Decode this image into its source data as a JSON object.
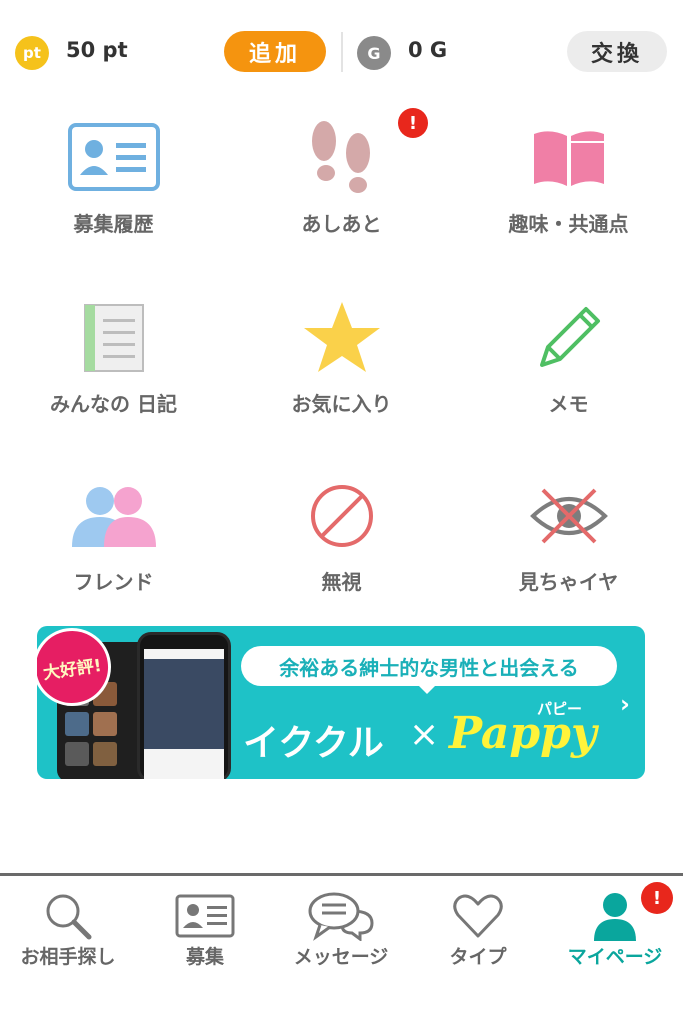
{
  "header": {
    "pt_icon": "pt",
    "points": "50 pt",
    "add_label": "追加",
    "g_icon": "G",
    "gold": "0 G",
    "exchange_label": "交換"
  },
  "menu": {
    "items": [
      {
        "label": "募集履歴",
        "icon": "id-card-icon"
      },
      {
        "label": "あしあと",
        "icon": "footprints-icon",
        "badge": "!"
      },
      {
        "label": "趣味・共通点",
        "icon": "open-book-icon"
      },
      {
        "label": "みんなの 日記",
        "icon": "notebook-icon"
      },
      {
        "label": "お気に入り",
        "icon": "star-icon"
      },
      {
        "label": "メモ",
        "icon": "pencil-icon"
      },
      {
        "label": "フレンド",
        "icon": "friends-icon"
      },
      {
        "label": "無視",
        "icon": "prohibited-icon"
      },
      {
        "label": "見ちゃイヤ",
        "icon": "eye-crossed-icon"
      }
    ]
  },
  "banner": {
    "badge": "大好評!",
    "headline": "余裕ある紳士的な男性と出会える",
    "brand_left": "イククル",
    "cross": "×",
    "brand_right": "Pappy",
    "brand_right_ruby": "パピー",
    "chevron": "›"
  },
  "nav": {
    "items": [
      {
        "label": "お相手探し",
        "icon": "search-icon"
      },
      {
        "label": "募集",
        "icon": "id-card-icon"
      },
      {
        "label": "メッセージ",
        "icon": "chat-bubbles-icon"
      },
      {
        "label": "タイプ",
        "icon": "heart-icon"
      },
      {
        "label": "マイページ",
        "icon": "person-icon",
        "active": true,
        "badge": "!"
      }
    ]
  },
  "colors": {
    "accent": "#0aa69d",
    "orange": "#f5940f",
    "badge_red": "#e8271c",
    "banner_bg": "#1ec2c7"
  }
}
